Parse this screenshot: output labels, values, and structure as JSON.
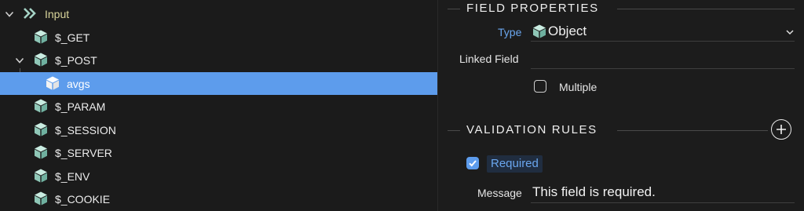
{
  "tree": {
    "root": {
      "label": "Input"
    },
    "items": [
      {
        "label": "$_GET"
      },
      {
        "label": "$_POST"
      },
      {
        "label": "avgs"
      },
      {
        "label": "$_PARAM"
      },
      {
        "label": "$_SESSION"
      },
      {
        "label": "$_SERVER"
      },
      {
        "label": "$_ENV"
      },
      {
        "label": "$_COOKIE"
      }
    ]
  },
  "field_properties": {
    "title": "FIELD PROPERTIES",
    "type_label": "Type",
    "type_value": "Object",
    "linked_field_label": "Linked Field",
    "linked_field_value": "",
    "multiple_label": "Multiple",
    "multiple_checked": false
  },
  "validation_rules": {
    "title": "VALIDATION RULES",
    "required_label": "Required",
    "required_checked": true,
    "message_label": "Message",
    "message_value": "This field is required."
  },
  "colors": {
    "accent": "#5d9cec",
    "cube": "#9fd3c4",
    "input_label": "#d8d49a",
    "background": "#1b1b1b"
  }
}
